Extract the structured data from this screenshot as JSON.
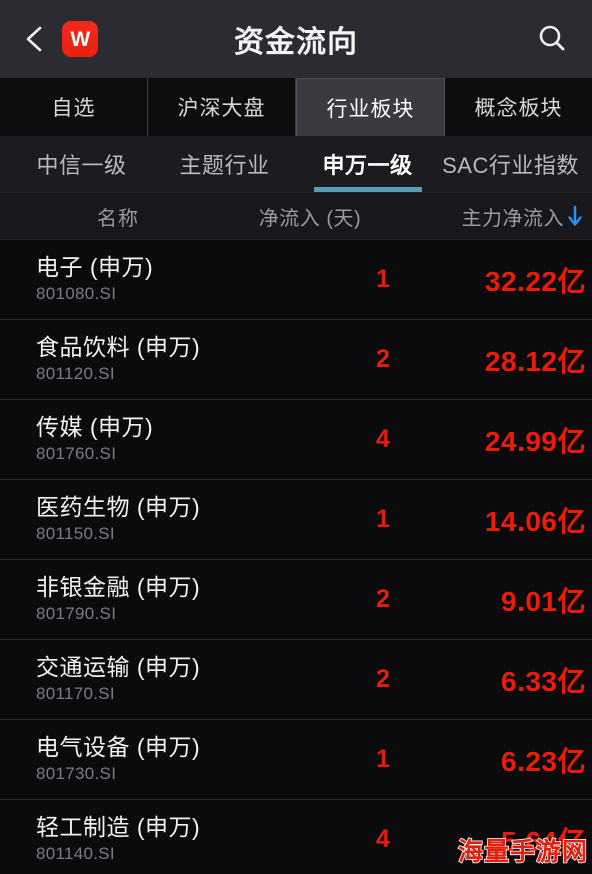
{
  "header": {
    "back_icon": "back-chevron-icon",
    "logo_text": "W",
    "title": "资金流向",
    "search_icon": "search-icon"
  },
  "tabs_primary": {
    "items": [
      {
        "label": "自选",
        "active": false
      },
      {
        "label": "沪深大盘",
        "active": false
      },
      {
        "label": "行业板块",
        "active": true
      },
      {
        "label": "概念板块",
        "active": false
      }
    ]
  },
  "tabs_secondary": {
    "items": [
      {
        "label": "中信一级",
        "active": false
      },
      {
        "label": "主题行业",
        "active": false
      },
      {
        "label": "申万一级",
        "active": true
      },
      {
        "label": "SAC行业指数",
        "active": false
      }
    ]
  },
  "table": {
    "columns": {
      "name": "名称",
      "days": "净流入 (天)",
      "main_inflow": "主力净流入",
      "sort_direction": "desc"
    },
    "rows": [
      {
        "name": "电子 (申万)",
        "code": "801080.SI",
        "days": "1",
        "value": "32.22亿"
      },
      {
        "name": "食品饮料 (申万)",
        "code": "801120.SI",
        "days": "2",
        "value": "28.12亿"
      },
      {
        "name": "传媒 (申万)",
        "code": "801760.SI",
        "days": "4",
        "value": "24.99亿"
      },
      {
        "name": "医药生物 (申万)",
        "code": "801150.SI",
        "days": "1",
        "value": "14.06亿"
      },
      {
        "name": "非银金融 (申万)",
        "code": "801790.SI",
        "days": "2",
        "value": "9.01亿"
      },
      {
        "name": "交通运输 (申万)",
        "code": "801170.SI",
        "days": "2",
        "value": "6.33亿"
      },
      {
        "name": "电气设备 (申万)",
        "code": "801730.SI",
        "days": "1",
        "value": "6.23亿"
      },
      {
        "name": "轻工制造 (申万)",
        "code": "801140.SI",
        "days": "4",
        "value": "5.64亿"
      }
    ]
  },
  "watermark": {
    "text": "海量手游网"
  },
  "colors": {
    "header_bg": "#2b2b31",
    "page_bg": "#0b0b0e",
    "accent_red": "#ee1b08",
    "logo_red": "#e81e10",
    "underline_blue": "#5f9cb5",
    "sort_blue": "#2196f3",
    "text_primary": "#f2f2f4",
    "text_muted": "#7b7b83"
  }
}
